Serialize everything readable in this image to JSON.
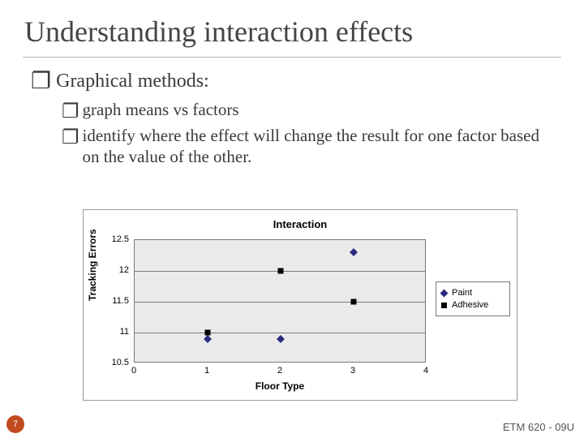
{
  "slide": {
    "title": "Understanding interaction effects",
    "bullet1": "Graphical methods:",
    "sub1": "graph means vs factors",
    "sub2": "identify where the effect will change the result for one factor based on the value of the other.",
    "page_number": "7",
    "footer": "ETM 620 - 09U",
    "bullet_glyph": "❐"
  },
  "chart_data": {
    "type": "scatter",
    "title": "Interaction",
    "xlabel": "Floor Type",
    "ylabel": "Tracking Errors",
    "xlim": [
      0,
      4
    ],
    "ylim": [
      10.5,
      12.5
    ],
    "yticks": [
      10.5,
      11,
      11.5,
      12,
      12.5
    ],
    "xticks": [
      0,
      1,
      2,
      3,
      4
    ],
    "grid": true,
    "series": [
      {
        "name": "Paint",
        "marker": "diamond",
        "x": [
          1,
          2,
          3
        ],
        "y": [
          10.9,
          10.9,
          12.3
        ]
      },
      {
        "name": "Adhesive",
        "marker": "square",
        "x": [
          1,
          2,
          3
        ],
        "y": [
          11.0,
          12.0,
          11.5
        ]
      }
    ]
  }
}
